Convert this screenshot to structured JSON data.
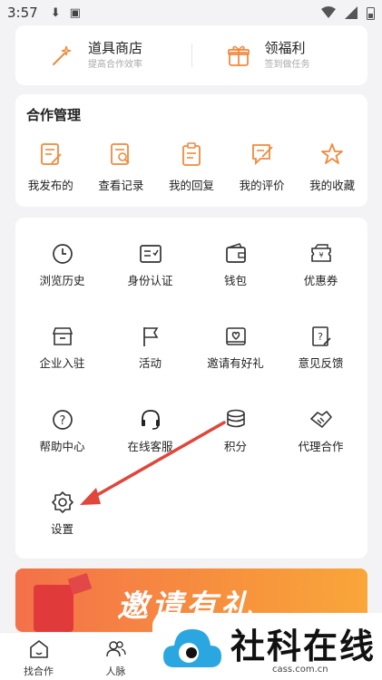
{
  "status_bar": {
    "time": "3:57"
  },
  "promos": [
    {
      "title": "道具商店",
      "subtitle": "提高合作效率",
      "icon": "magic-wand-icon"
    },
    {
      "title": "领福利",
      "subtitle": "签到做任务",
      "icon": "gift-icon"
    }
  ],
  "cooperation": {
    "title": "合作管理",
    "items": [
      {
        "label": "我发布的",
        "icon": "edit-document-icon"
      },
      {
        "label": "查看记录",
        "icon": "search-document-icon"
      },
      {
        "label": "我的回复",
        "icon": "clipboard-icon"
      },
      {
        "label": "我的评价",
        "icon": "comment-edit-icon"
      },
      {
        "label": "我的收藏",
        "icon": "star-icon"
      }
    ]
  },
  "services": [
    {
      "label": "浏览历史",
      "icon": "clock-icon"
    },
    {
      "label": "身份认证",
      "icon": "id-card-icon"
    },
    {
      "label": "钱包",
      "icon": "wallet-icon"
    },
    {
      "label": "优惠券",
      "icon": "coupon-icon"
    },
    {
      "label": "企业入驻",
      "icon": "storefront-icon"
    },
    {
      "label": "活动",
      "icon": "flag-icon"
    },
    {
      "label": "邀请有好礼",
      "icon": "invite-gift-icon"
    },
    {
      "label": "意见反馈",
      "icon": "feedback-icon"
    },
    {
      "label": "帮助中心",
      "icon": "help-icon"
    },
    {
      "label": "在线客服",
      "icon": "headset-icon"
    },
    {
      "label": "积分",
      "icon": "coins-icon"
    },
    {
      "label": "代理合作",
      "icon": "handshake-icon"
    },
    {
      "label": "设置",
      "icon": "gear-icon"
    }
  ],
  "banner": {
    "text": "邀请有礼"
  },
  "tabbar": [
    {
      "label": "找合作",
      "icon": "home-icon"
    },
    {
      "label": "人脉",
      "icon": "contacts-icon"
    }
  ],
  "watermark": {
    "title": "社科在线",
    "url": "cass.com.cn"
  },
  "colors": {
    "accent": "#f08a3c",
    "annotation_arrow": "#e0463a"
  }
}
